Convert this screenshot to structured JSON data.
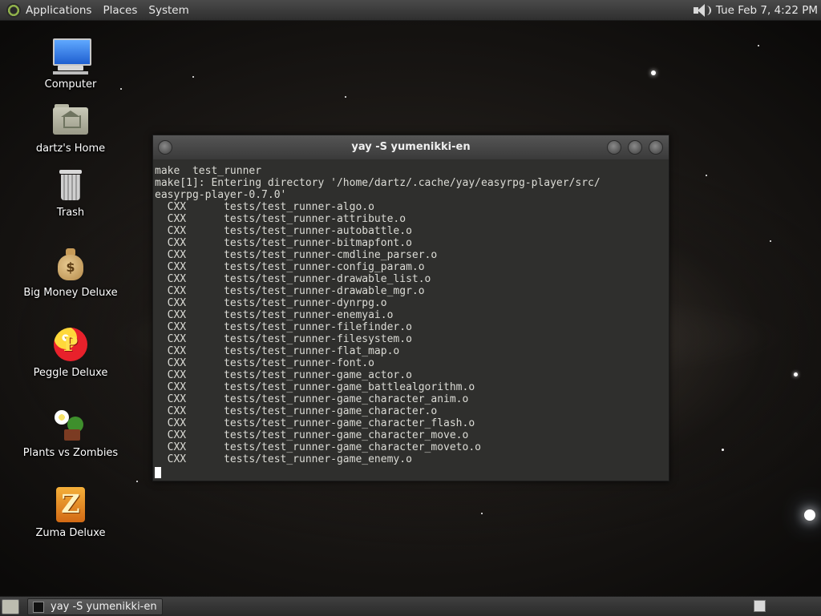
{
  "top_panel": {
    "menus": [
      "Applications",
      "Places",
      "System"
    ],
    "clock": "Tue Feb  7,  4:22 PM"
  },
  "desktop_icons": [
    {
      "label": "Computer",
      "icon": "computer-icon"
    },
    {
      "label": "dartz's Home",
      "icon": "home-folder-icon"
    },
    {
      "label": "Trash",
      "icon": "trash-icon"
    },
    {
      "label": "Big Money Deluxe",
      "icon": "money-bag-icon"
    },
    {
      "label": "Peggle Deluxe",
      "icon": "peggle-icon"
    },
    {
      "label": "Plants vs Zombies",
      "icon": "plants-vs-zombies-icon"
    },
    {
      "label": "Zuma Deluxe",
      "icon": "zuma-icon"
    }
  ],
  "window": {
    "title": "yay -S yumenikki-en",
    "lines": [
      "make  test_runner",
      "make[1]: Entering directory '/home/dartz/.cache/yay/easyrpg-player/src/",
      "easyrpg-player-0.7.0'",
      "  CXX      tests/test_runner-algo.o",
      "  CXX      tests/test_runner-attribute.o",
      "  CXX      tests/test_runner-autobattle.o",
      "  CXX      tests/test_runner-bitmapfont.o",
      "  CXX      tests/test_runner-cmdline_parser.o",
      "  CXX      tests/test_runner-config_param.o",
      "  CXX      tests/test_runner-drawable_list.o",
      "  CXX      tests/test_runner-drawable_mgr.o",
      "  CXX      tests/test_runner-dynrpg.o",
      "  CXX      tests/test_runner-enemyai.o",
      "  CXX      tests/test_runner-filefinder.o",
      "  CXX      tests/test_runner-filesystem.o",
      "  CXX      tests/test_runner-flat_map.o",
      "  CXX      tests/test_runner-font.o",
      "  CXX      tests/test_runner-game_actor.o",
      "  CXX      tests/test_runner-game_battlealgorithm.o",
      "  CXX      tests/test_runner-game_character_anim.o",
      "  CXX      tests/test_runner-game_character.o",
      "  CXX      tests/test_runner-game_character_flash.o",
      "  CXX      tests/test_runner-game_character_move.o",
      "  CXX      tests/test_runner-game_character_moveto.o",
      "  CXX      tests/test_runner-game_enemy.o"
    ]
  },
  "taskbar": {
    "task_label": "yay -S yumenikki-en"
  }
}
